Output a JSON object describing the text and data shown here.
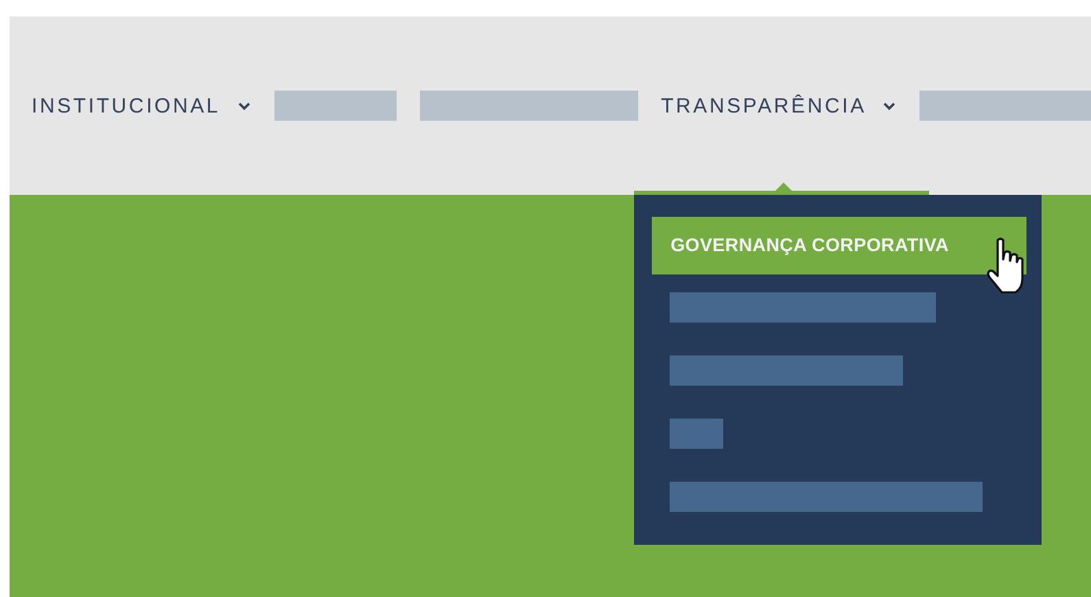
{
  "nav": {
    "items": [
      {
        "kind": "link",
        "label": "INSTITUCIONAL"
      },
      {
        "kind": "redacted"
      },
      {
        "kind": "redacted"
      },
      {
        "kind": "link",
        "label": "TRANSPARÊNCIA",
        "submenu": {
          "items": [
            {
              "kind": "link",
              "label": "GOVERNANÇA CORPORATIVA",
              "selected": true
            },
            {
              "kind": "redacted",
              "selected": false
            },
            {
              "kind": "redacted",
              "selected": false
            },
            {
              "kind": "redacted",
              "selected": false
            },
            {
              "kind": "redacted",
              "selected": false
            }
          ]
        }
      },
      {
        "kind": "redacted"
      }
    ]
  }
}
